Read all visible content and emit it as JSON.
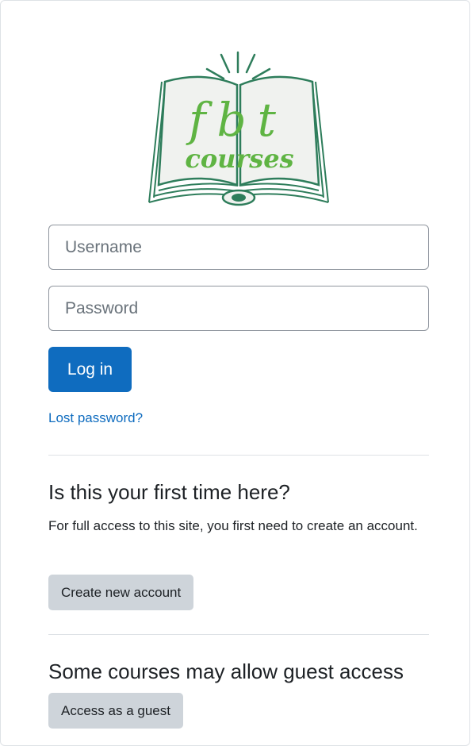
{
  "logo": {
    "line1": "fbt",
    "line2": "courses",
    "accent_green": "#5fb443",
    "book_green": "#2e7d5b"
  },
  "login": {
    "username_placeholder": "Username",
    "password_placeholder": "Password",
    "login_label": "Log in",
    "lost_password_label": "Lost password?"
  },
  "signup": {
    "heading": "Is this your first time here?",
    "description": "For full access to this site, you first need to create an account.",
    "create_label": "Create new account"
  },
  "guest": {
    "heading": "Some courses may allow guest access",
    "guest_label": "Access as a guest"
  },
  "colors": {
    "primary": "#0f6cbf",
    "secondary": "#ced4da"
  }
}
